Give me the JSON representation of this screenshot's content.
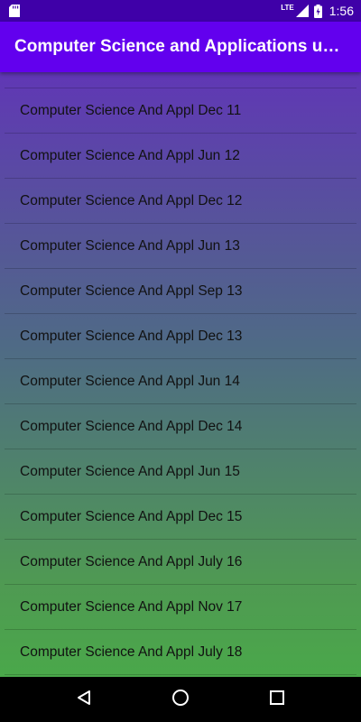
{
  "status_bar": {
    "network": "LTE",
    "time": "1:56"
  },
  "app_bar": {
    "title": "Computer Science and Applications u…"
  },
  "list": {
    "items": [
      "",
      "Computer Science And Appl Dec 11",
      "Computer Science And Appl Jun 12",
      "Computer Science And Appl Dec 12",
      "Computer Science And Appl Jun 13",
      "Computer Science And Appl Sep 13",
      "Computer Science And Appl Dec 13",
      "Computer Science And Appl Jun 14",
      "Computer Science And Appl Dec 14",
      "Computer Science And Appl Jun 15",
      "Computer Science And Appl Dec 15",
      "Computer Science And Appl July 16",
      "Computer Science And Appl Nov 17",
      "Computer Science And Appl July 18",
      ""
    ]
  },
  "nav_bar": {
    "icons": [
      "back-icon",
      "home-icon",
      "recents-icon"
    ]
  },
  "colors": {
    "status_bar": "#3f00a8",
    "app_bar": "#6200ee",
    "gradient_top": "#6037b5",
    "gradient_bottom": "#4aa84a"
  }
}
